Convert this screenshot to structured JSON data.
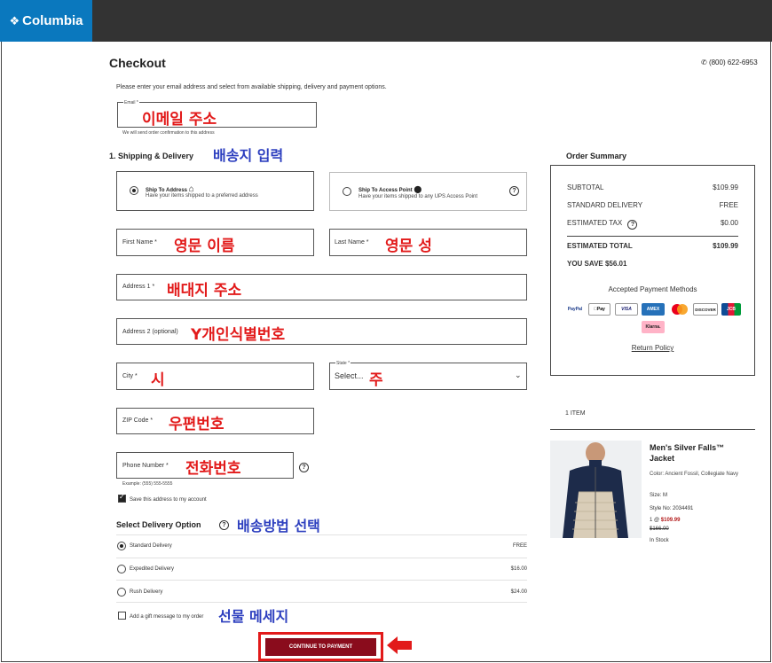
{
  "header": {
    "brand": "Columbia"
  },
  "checkout": {
    "title": "Checkout",
    "phone": "(800) 622-6953",
    "intro": "Please enter your email address and select from available shipping, delivery and payment options."
  },
  "email": {
    "label": "Email *",
    "annotation": "이메일 주소",
    "helper": "We will send order confirmation to this address"
  },
  "shipping": {
    "heading": "1. Shipping & Delivery",
    "annotation": "배송지 입력",
    "ship_to_address": {
      "title": "Ship To Address",
      "desc": "Have your items shipped to a preferred address"
    },
    "ship_to_access_point": {
      "title": "Ship To Access Point",
      "desc": "Have your items shipped to any UPS Access Point"
    }
  },
  "form": {
    "first_name": {
      "label": "First Name *",
      "annotation": "영문 이름"
    },
    "last_name": {
      "label": "Last Name *",
      "annotation": "영문 성"
    },
    "address1": {
      "label": "Address 1 *",
      "annotation": "배대지 주소"
    },
    "address2": {
      "label": "Address 2 (optional)",
      "annotation": "Y개인식별번호"
    },
    "city": {
      "label": "City *",
      "annotation": "시"
    },
    "state": {
      "label": "State *",
      "value": "Select...",
      "annotation": "주"
    },
    "zip": {
      "label": "ZIP Code *",
      "annotation": "우편번호"
    },
    "phone": {
      "label": "Phone Number *",
      "annotation": "전화번호",
      "example": "Example: (555) 555-5555"
    },
    "save_address": "Save this address to my account"
  },
  "delivery": {
    "heading": "Select Delivery Option",
    "annotation": "배송방법 선택",
    "options": [
      {
        "name": "Standard Delivery",
        "price": "FREE"
      },
      {
        "name": "Expedited Delivery",
        "price": "$16.00"
      },
      {
        "name": "Rush Delivery",
        "price": "$24.00"
      }
    ],
    "gift_label": "Add a gift message to my order",
    "gift_annotation": "선물 메세지"
  },
  "continue_button": "CONTINUE TO PAYMENT",
  "summary": {
    "heading": "Order Summary",
    "subtotal_label": "SUBTOTAL",
    "subtotal": "$109.99",
    "delivery_label": "STANDARD DELIVERY",
    "delivery": "FREE",
    "tax_label": "ESTIMATED TAX",
    "tax": "$0.00",
    "total_label": "ESTIMATED TOTAL",
    "total": "$109.99",
    "save": "YOU SAVE $56.01",
    "accepted": "Accepted Payment Methods",
    "methods": [
      "PayPal",
      "Pay",
      "VISA",
      "AMEX",
      "",
      "DISCOVER",
      "JCB",
      "Klarna."
    ],
    "return_policy": "Return Policy"
  },
  "cart": {
    "count": "1 ITEM",
    "product": {
      "name": "Men's Silver Falls™ Jacket",
      "color": "Color: Ancient Fossil, Collegiate Navy",
      "size": "Size: M",
      "style": "Style No: 2034491",
      "qty": "1 @",
      "price": "$109.99",
      "old_price": "$166.00",
      "stock": "In Stock"
    }
  },
  "colors": {
    "brand_blue": "#0a78be",
    "topbar": "#333333",
    "button": "#8a0c1c",
    "annotation_red": "#e21a1a",
    "annotation_blue": "#2d3fbf"
  }
}
